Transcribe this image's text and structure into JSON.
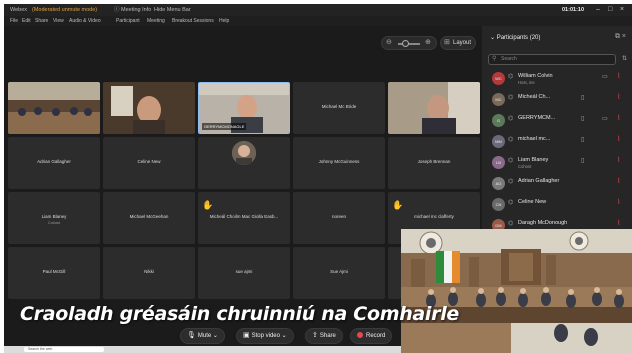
{
  "titlebar": {
    "app_name": "Webex",
    "mode": "(Moderated unmute mode)",
    "meeting_info": "Meeting Info",
    "hide_menu": "Hide Menu Bar",
    "timer": "01:01:10"
  },
  "menu": [
    "File",
    "Edit",
    "Share",
    "View",
    "Audio & Video",
    "Participant",
    "Meeting",
    "Breakout Sessions",
    "Help"
  ],
  "toolbar_top": {
    "layout_label": "Layout"
  },
  "tiles": [
    {
      "name": "",
      "kind": "room"
    },
    {
      "name": "",
      "kind": "person1"
    },
    {
      "name": "GERRYMCMONAGLE",
      "kind": "person2",
      "active": true
    },
    {
      "name": "Michael Mc Bride",
      "kind": "blank"
    },
    {
      "name": "",
      "kind": "person3"
    },
    {
      "name": "Adrian Gallagher",
      "kind": "blank"
    },
    {
      "name": "Celine New",
      "kind": "blank"
    },
    {
      "name": "",
      "kind": "avatar"
    },
    {
      "name": "Johnny McGuinness",
      "kind": "blank"
    },
    {
      "name": "Joseph Brennan",
      "kind": "blank"
    },
    {
      "name": "Liam Blaney",
      "sub": "Cohost",
      "kind": "blank"
    },
    {
      "name": "Michael McGeehan",
      "kind": "blank"
    },
    {
      "name": "Micheál Choilm Mac Giolla Easb...",
      "kind": "blank",
      "hand": true
    },
    {
      "name": "noreen",
      "kind": "blank"
    },
    {
      "name": "michael mc clafferty",
      "kind": "blank",
      "hand": true
    },
    {
      "name": "Paul McGill",
      "kind": "blank"
    },
    {
      "name": "Nikki",
      "kind": "blank"
    },
    {
      "name": "sue ajmi",
      "kind": "blank"
    },
    {
      "name": "Sue Ajmi",
      "kind": "blank"
    },
    {
      "name": "",
      "kind": "blank"
    }
  ],
  "participants_panel": {
    "title": "Participants (20)",
    "search_placeholder": "Search",
    "rows": [
      {
        "initials": "WC",
        "name": "William Colvin",
        "role": "Host, me"
      },
      {
        "initials": "MC",
        "name": "Micheál Ch...",
        "role": ""
      },
      {
        "initials": "G",
        "name": "GERRYMCM...",
        "role": ""
      },
      {
        "initials": "MM",
        "name": "michael mc...",
        "role": ""
      },
      {
        "initials": "LB",
        "name": "Liam Blaney",
        "role": "Cohost"
      },
      {
        "initials": "AG",
        "name": "Adrian Gallagher",
        "role": ""
      },
      {
        "initials": "CN",
        "name": "Celine New",
        "role": ""
      },
      {
        "initials": "DM",
        "name": "Daragh McDonough",
        "role": ""
      }
    ]
  },
  "bottom_toolbar": {
    "mute": "Mute",
    "stop_video": "Stop video",
    "share": "Share",
    "record": "Record"
  },
  "taskbar": {
    "search": "Search the web"
  },
  "caption": "Craoladh gréasáin chruinniú na Comhairle",
  "colors": {
    "accent": "#8fbff3",
    "muted": "#e5484d",
    "hand": "#f2b428"
  }
}
